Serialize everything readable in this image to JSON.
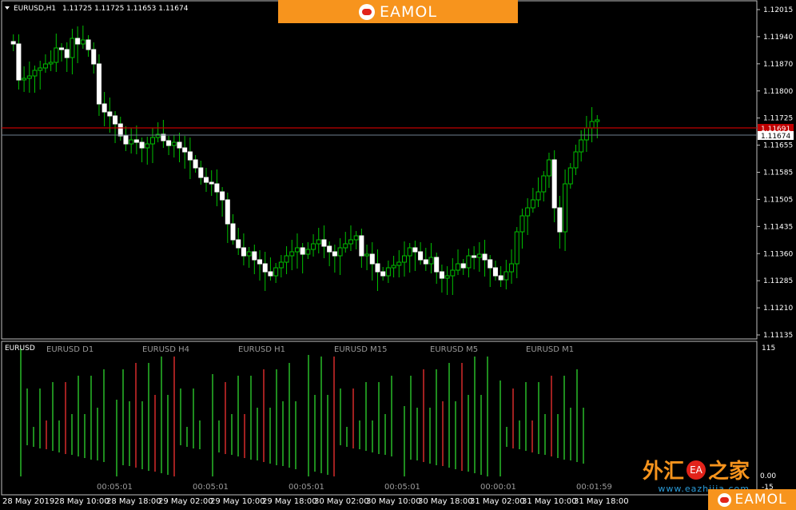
{
  "chart": {
    "symbol_header": "EURUSD,H1",
    "ohlc_header": "1.11725 1.11725 1.11653 1.11674",
    "bid_price_label": "1.11674",
    "red_line_label": "1.11691",
    "price_scale": [
      "1.12015",
      "1.11940",
      "1.11870",
      "1.11800",
      "1.11725",
      "1.11655",
      "1.11585",
      "1.11505",
      "1.11435",
      "1.11360",
      "1.11285",
      "1.11210",
      "1.11135"
    ],
    "colors": {
      "bull": "#00c000",
      "bear_body": "#ffffff",
      "red_line": "#c00000",
      "bid_line": "#708090",
      "grid": "#c0c0c0"
    }
  },
  "indicator": {
    "title": "EURUSD",
    "timeframes": [
      "EURUSD D1",
      "EURUSD H4",
      "EURUSD H1",
      "EURUSD M15",
      "EURUSD M5",
      "EURUSD M1"
    ],
    "countdowns": [
      "00:05:01",
      "00:05:01",
      "00:05:01",
      "00:05:01",
      "00:00:01",
      "00:01:59"
    ],
    "scale_top": "115",
    "scale_zero": "0.00",
    "scale_bottom": "-15",
    "colors": {
      "up": "#1e8c1e",
      "down": "#a02020"
    }
  },
  "time_axis": [
    "28 May 2019",
    "28 May 10:00",
    "28 May 18:00",
    "29 May 02:00",
    "29 May 10:00",
    "29 May 18:00",
    "30 May 02:00",
    "30 May 10:00",
    "30 May 18:00",
    "31 May 02:00",
    "31 May 10:00",
    "31 May 18:00"
  ],
  "branding": {
    "top_banner": "EAMOL",
    "bottom_badge": "EAMOL",
    "watermark_cn_1": "外汇",
    "watermark_seal": "EA",
    "watermark_cn_2": "之家",
    "watermark_url": "www.eazhijia.com"
  }
}
